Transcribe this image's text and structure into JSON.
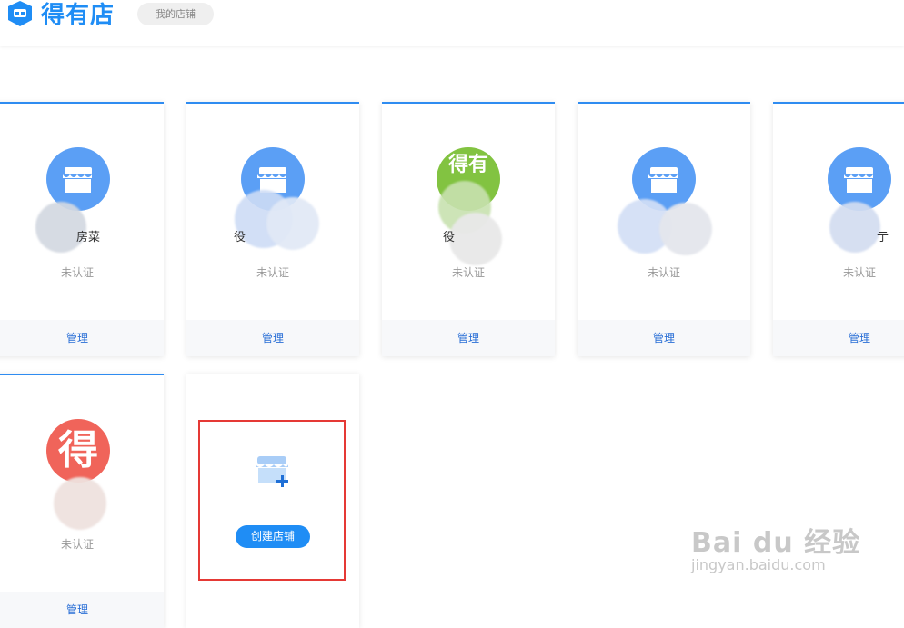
{
  "header": {
    "logo_text": "得有店",
    "my_stores_tab": "我的店铺"
  },
  "stores": [
    {
      "name": "房菜",
      "status": "未认证",
      "manage": "管理",
      "avatar": "store-icon"
    },
    {
      "name": "役",
      "status": "未认证",
      "manage": "管理",
      "avatar": "store-icon"
    },
    {
      "name": "役",
      "status": "未认证",
      "manage": "管理",
      "avatar": "得有店-logo"
    },
    {
      "name": "",
      "status": "未认证",
      "manage": "管理",
      "avatar": "store-icon"
    },
    {
      "name": "亍",
      "status": "未认证",
      "manage": "管理",
      "avatar": "store-icon"
    },
    {
      "name": "",
      "status": "未认证",
      "manage": "管理",
      "avatar": "得-logo"
    }
  ],
  "create": {
    "button_label": "创建店铺"
  },
  "avatar_text": {
    "green_top": "得有",
    "red": "得"
  },
  "watermark": {
    "line1": "Bai du 经验",
    "line2": "jingyan.baidu.com"
  },
  "colors": {
    "brand_blue": "#1f8df5",
    "avatar_blue": "#5b9ff5",
    "avatar_green": "#82c341",
    "avatar_red": "#f0645a",
    "highlight_red": "#e53935"
  }
}
